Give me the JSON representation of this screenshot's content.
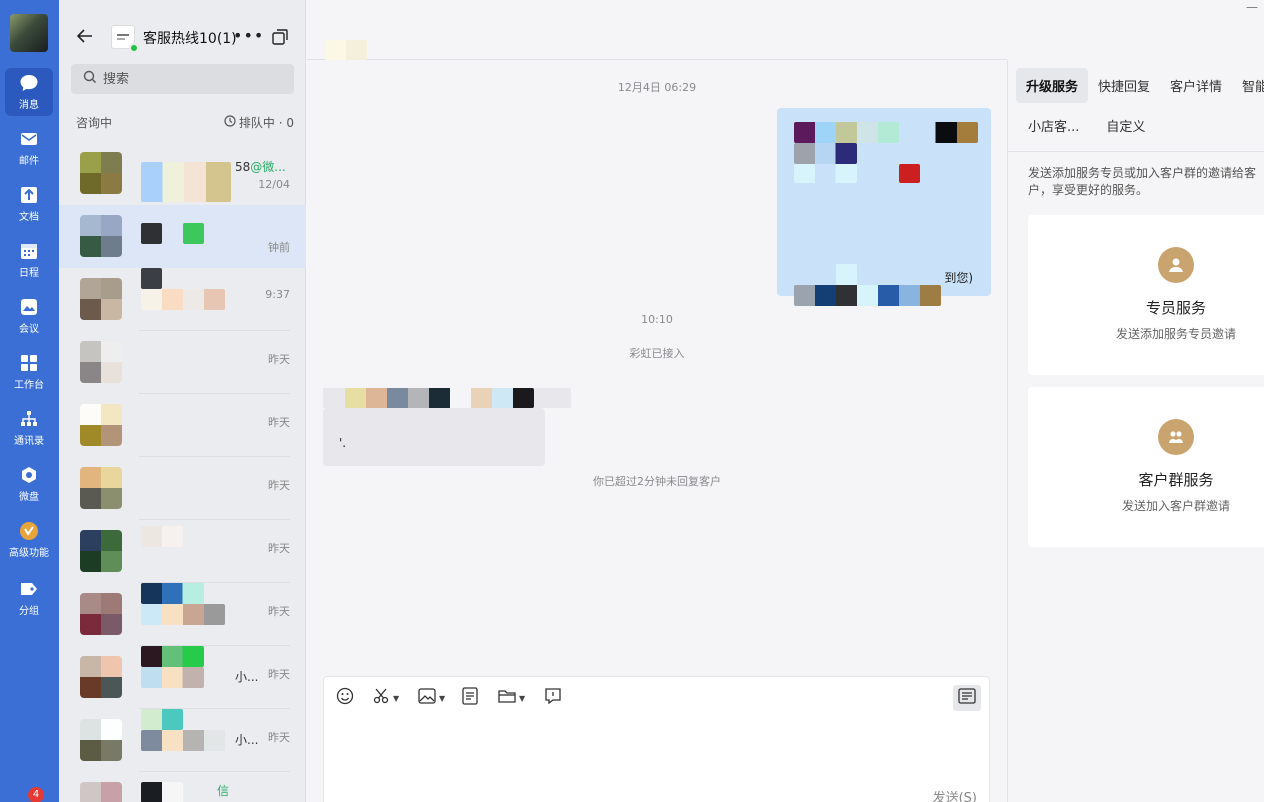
{
  "nav": {
    "items": [
      {
        "label": "消息",
        "icon": "chat-bubble-icon"
      },
      {
        "label": "邮件",
        "icon": "mail-icon"
      },
      {
        "label": "文档",
        "icon": "document-icon"
      },
      {
        "label": "日程",
        "icon": "calendar-icon"
      },
      {
        "label": "会议",
        "icon": "meeting-icon"
      },
      {
        "label": "工作台",
        "icon": "workbench-icon"
      },
      {
        "label": "通讯录",
        "icon": "contacts-icon"
      },
      {
        "label": "微盘",
        "icon": "cloud-drive-icon"
      },
      {
        "label": "高级功能",
        "icon": "premium-icon"
      },
      {
        "label": "分组",
        "icon": "group-tag-icon"
      }
    ],
    "badge": "4"
  },
  "conversation": {
    "title": "客服热线10(1)",
    "more": "•••"
  },
  "search": {
    "placeholder": "搜索"
  },
  "filter": {
    "left": "咨询中",
    "queue": "排队中 · 0"
  },
  "rows": [
    {
      "name": "58",
      "tag": "@微...",
      "time": "12/04"
    },
    {
      "name": "",
      "tag": "",
      "time": "钟前"
    },
    {
      "name": "",
      "tag": "",
      "time": "9:37"
    },
    {
      "name": "",
      "tag": "",
      "time": "昨天"
    },
    {
      "name": "",
      "tag": "",
      "time": "昨天"
    },
    {
      "name": "",
      "tag": "",
      "time": "昨天"
    },
    {
      "name": "",
      "tag": "",
      "time": "昨天"
    },
    {
      "name": "",
      "tag": "",
      "time": "昨天"
    },
    {
      "name": "小...",
      "tag": "",
      "time": "昨天"
    },
    {
      "name": "小...",
      "tag": "",
      "time": "昨天"
    },
    {
      "name": "",
      "tag": "信",
      "time": ""
    }
  ],
  "chat": {
    "time1": "12月4日 06:29",
    "bubble_tail": "到您)",
    "time2": "10:10",
    "joined": "彩虹已接入",
    "left_text": "'.",
    "warning": "你已超过2分钟未回复客户",
    "send": "发送(S)"
  },
  "panel": {
    "tabs": [
      "升级服务",
      "快捷回复",
      "客户详情",
      "智能"
    ],
    "subtabs": [
      "小店客...",
      "自定义"
    ],
    "desc": "发送添加服务专员或加入客户群的邀请给客户，享受更好的服务。",
    "card1": {
      "title": "专员服务",
      "sub": "发送添加服务专员邀请"
    },
    "card2": {
      "title": "客户群服务",
      "sub": "发送加入客户群邀请"
    }
  },
  "window": {
    "minimize": "—"
  }
}
